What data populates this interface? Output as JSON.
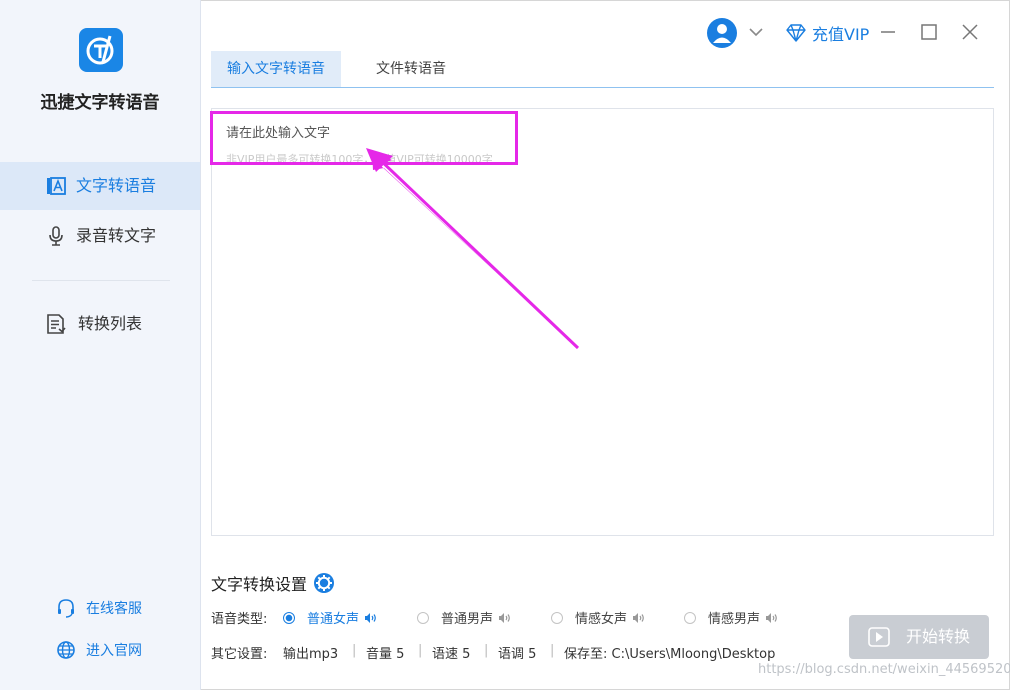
{
  "app": {
    "name": "迅捷文字转语音",
    "logo_letter": "T"
  },
  "sidebar": {
    "items": [
      {
        "label": "文字转语音",
        "icon": "text-to-speech-icon",
        "active": true
      },
      {
        "label": "录音转文字",
        "icon": "microphone-icon",
        "active": false
      },
      {
        "label": "转换列表",
        "icon": "document-list-icon",
        "active": false
      }
    ],
    "footer": [
      {
        "label": "在线客服",
        "icon": "headset-icon"
      },
      {
        "label": "进入官网",
        "icon": "globe-icon"
      }
    ]
  },
  "titlebar": {
    "vip_label": "充值VIP"
  },
  "tabs": [
    {
      "label": "输入文字转语音",
      "active": true
    },
    {
      "label": "文件转语音",
      "active": false
    }
  ],
  "editor": {
    "placeholder": "请在此处输入文字",
    "hint": "非VIP用户最多可转换100字，充值VIP可转换10000字"
  },
  "settings": {
    "title": "文字转换设置",
    "voice_type_label": "语音类型:",
    "voice_options": [
      {
        "label": "普通女声",
        "selected": true
      },
      {
        "label": "普通男声",
        "selected": false
      },
      {
        "label": "情感女声",
        "selected": false
      },
      {
        "label": "情感男声",
        "selected": false
      }
    ],
    "other_label": "其它设置:",
    "output": "输出mp3",
    "volume": "音量 5",
    "speed": "语速 5",
    "pitch": "语调 5",
    "save_to": "保存至: C:\\Users\\Mloong\\Desktop"
  },
  "start_button": "开始转换",
  "watermark": "https://blog.csdn.net/weixin_44569520",
  "colors": {
    "accent": "#1a7ee0",
    "annotation": "#e528e8",
    "sidebar_bg": "#f2f5fb",
    "disabled_button": "#c9cdd3"
  }
}
